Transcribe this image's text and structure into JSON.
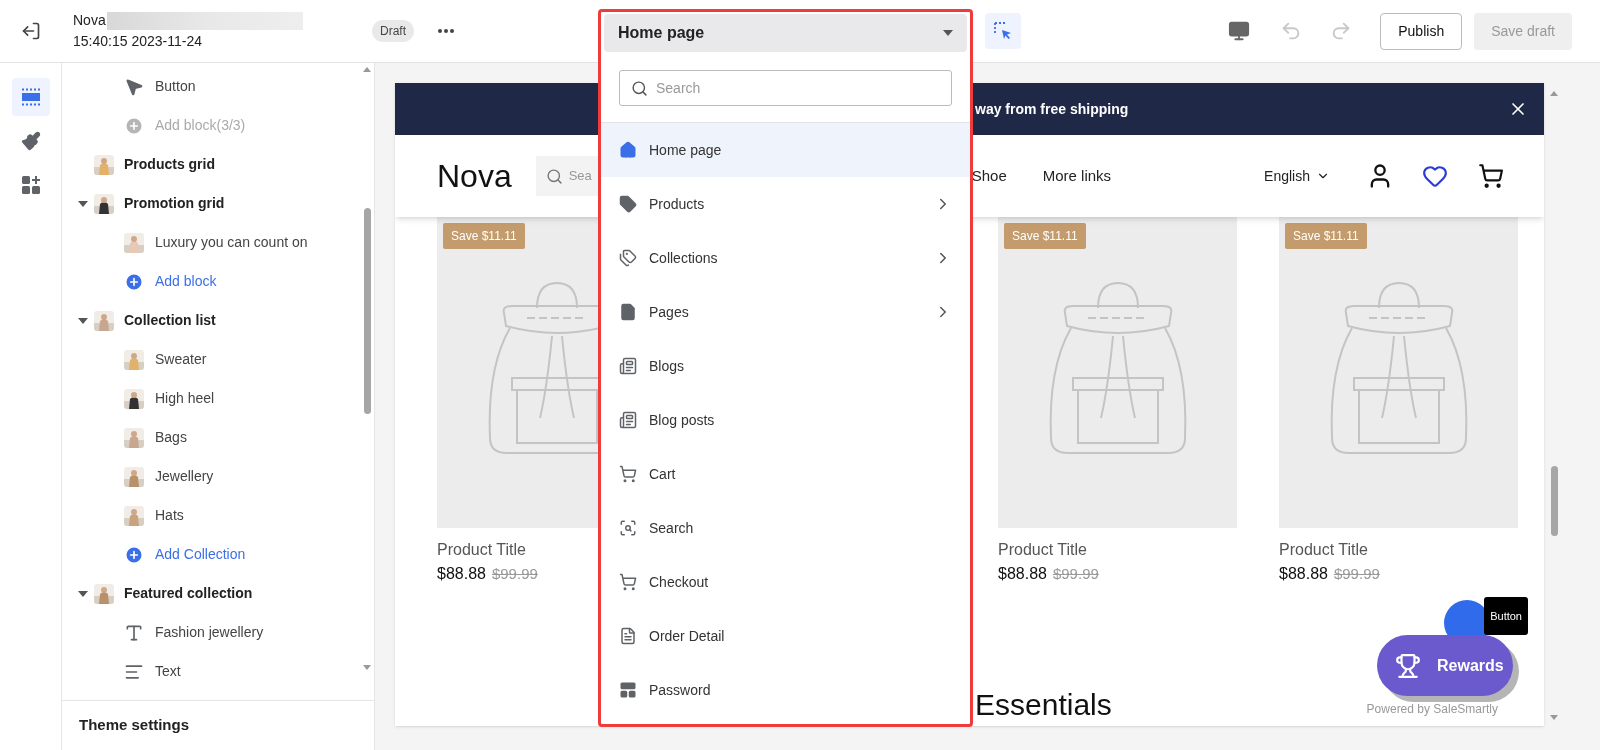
{
  "topbar": {
    "title": "Nova",
    "timestamp": "15:40:15 2023-11-24",
    "status": "Draft",
    "select_tool": {
      "selected": true
    },
    "history": [
      {
        "kind": "undo",
        "disabled": true
      },
      {
        "kind": "redo",
        "disabled": true
      }
    ],
    "actions": [
      {
        "kind": "publish",
        "label": "Publish",
        "disabled": false
      },
      {
        "kind": "save",
        "label": "Save draft",
        "disabled": true
      }
    ]
  },
  "rail": [
    {
      "kind": "sections",
      "selected": true
    },
    {
      "kind": "theme",
      "selected": false
    },
    {
      "kind": "apps",
      "selected": false
    }
  ],
  "sidebar": {
    "sections": [
      {
        "children": [
          {
            "kind": "button",
            "label": "Button"
          },
          {
            "kind": "add",
            "label": "Add block(3/3)",
            "disabled": true
          }
        ]
      },
      {
        "label": "Products grid"
      },
      {
        "label": "Promotion grid",
        "expanded": true,
        "children": [
          {
            "kind": "picture",
            "label": "Luxury you can count on"
          },
          {
            "kind": "add",
            "label": "Add block",
            "disabled": false
          }
        ]
      },
      {
        "label": "Collection list",
        "expanded": true,
        "children": [
          {
            "kind": "picture",
            "label": "Sweater"
          },
          {
            "kind": "picture",
            "label": "High heel"
          },
          {
            "kind": "picture",
            "label": "Bags"
          },
          {
            "kind": "picture",
            "label": "Jewellery"
          },
          {
            "kind": "picture",
            "label": "Hats"
          },
          {
            "kind": "add",
            "label": "Add Collection",
            "disabled": false
          }
        ]
      },
      {
        "label": "Featured collection",
        "expanded": true,
        "children": [
          {
            "kind": "heading",
            "label": "Fashion jewellery"
          },
          {
            "kind": "text",
            "label": "Text"
          }
        ]
      }
    ],
    "footer": "Theme settings"
  },
  "page_picker": {
    "value": "Home page",
    "search_placeholder": "Search",
    "items": [
      {
        "kind": "home",
        "label": "Home page",
        "selected": true,
        "has_children": false
      },
      {
        "kind": "product",
        "label": "Products",
        "selected": false,
        "has_children": true
      },
      {
        "kind": "collection",
        "label": "Collections",
        "selected": false,
        "has_children": true
      },
      {
        "kind": "page",
        "label": "Pages",
        "selected": false,
        "has_children": true
      },
      {
        "kind": "blog",
        "label": "Blogs",
        "selected": false,
        "has_children": false
      },
      {
        "kind": "blog",
        "label": "Blog posts",
        "selected": false,
        "has_children": false
      },
      {
        "kind": "cart",
        "label": "Cart",
        "selected": false,
        "has_children": false
      },
      {
        "kind": "search",
        "label": "Search",
        "selected": false,
        "has_children": false
      },
      {
        "kind": "cart",
        "label": "Checkout",
        "selected": false,
        "has_children": false
      },
      {
        "kind": "order",
        "label": "Order Detail",
        "selected": false,
        "has_children": false
      },
      {
        "kind": "password",
        "label": "Password",
        "selected": false,
        "has_children": false
      }
    ]
  },
  "preview": {
    "announcement": "way from free shipping",
    "logo": "Nova",
    "search_placeholder": "Sea",
    "nav": [
      "Shoe",
      "More links"
    ],
    "language": "English",
    "products": [
      {
        "badge": "Save $11.11",
        "title": "Product Title",
        "price": "$88.88",
        "compare_price": "$99.99"
      },
      {
        "badge": "Save $11.11",
        "title": "Product Title",
        "price": "$88.88",
        "compare_price": "$99.99"
      },
      {
        "badge": "Save $11.11",
        "title": "Product Title",
        "price": "$88.88",
        "compare_price": "$99.99"
      }
    ],
    "heading": "Essentials",
    "widget": {
      "tooltip": "Button",
      "rewards": "Rewards",
      "powered_by": "Powered by SaleSmartly"
    }
  }
}
